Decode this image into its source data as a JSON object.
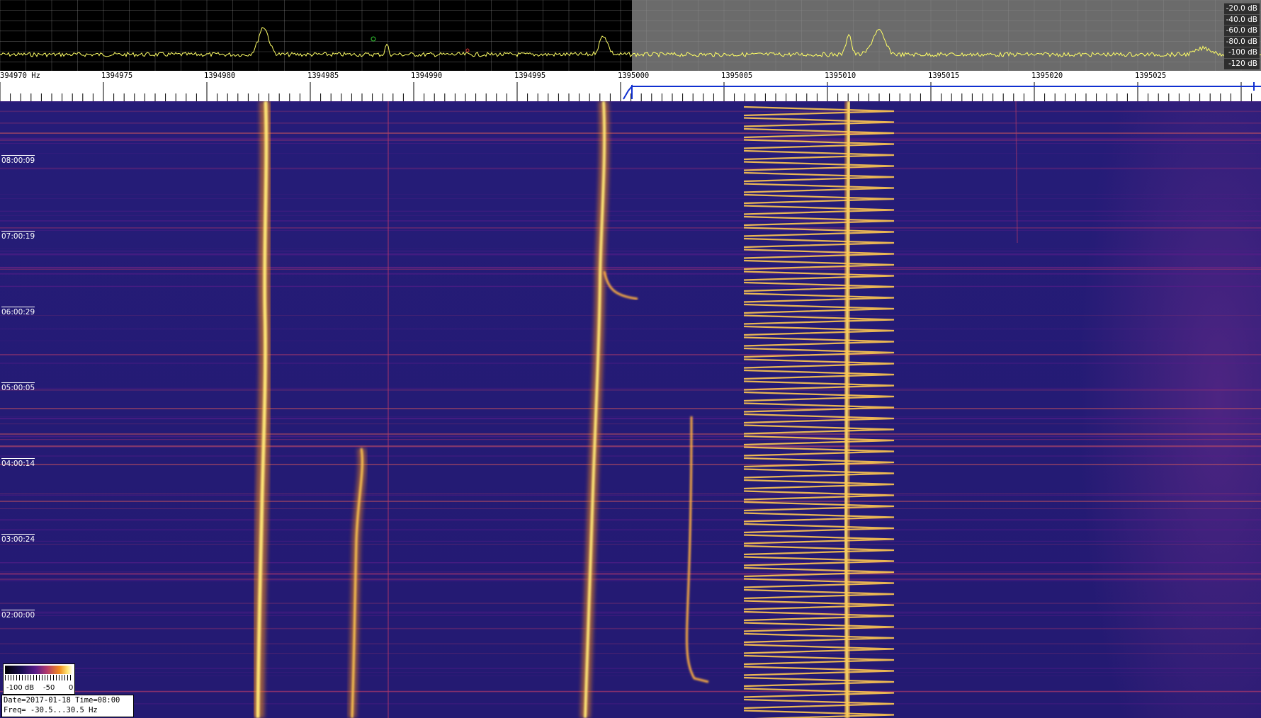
{
  "spectrum": {
    "db_labels": [
      "-20.0 dB",
      "-40.0 dB",
      "-60.0 dB",
      "-80.0 dB",
      "-100 dB",
      "-120 dB"
    ],
    "trace_color": "#ffff66",
    "selection_color": "#6b6b6b"
  },
  "frequency_axis": {
    "labels": [
      "394970 Hz",
      "1394975",
      "1394980",
      "1394985",
      "1394990",
      "1394995",
      "1395000",
      "1395005",
      "1395010",
      "1395015",
      "1395020",
      "1395025"
    ],
    "marker_color": "#1030d0"
  },
  "waterfall": {
    "time_labels": [
      "08:00:09",
      "07:00:19",
      "06:00:29",
      "05:00:05",
      "04:00:14",
      "03:00:24",
      "02:00:00"
    ],
    "palette": [
      "#20186e",
      "#5a1d8a",
      "#b43a6a",
      "#f08a1e",
      "#ffe676"
    ]
  },
  "legend": {
    "labels": [
      "-100 dB",
      "-50",
      "0"
    ]
  },
  "status": {
    "line1": "Date=2017-01-18 Time=08:00",
    "line2": "Freq= -30.5...30.5 Hz"
  }
}
